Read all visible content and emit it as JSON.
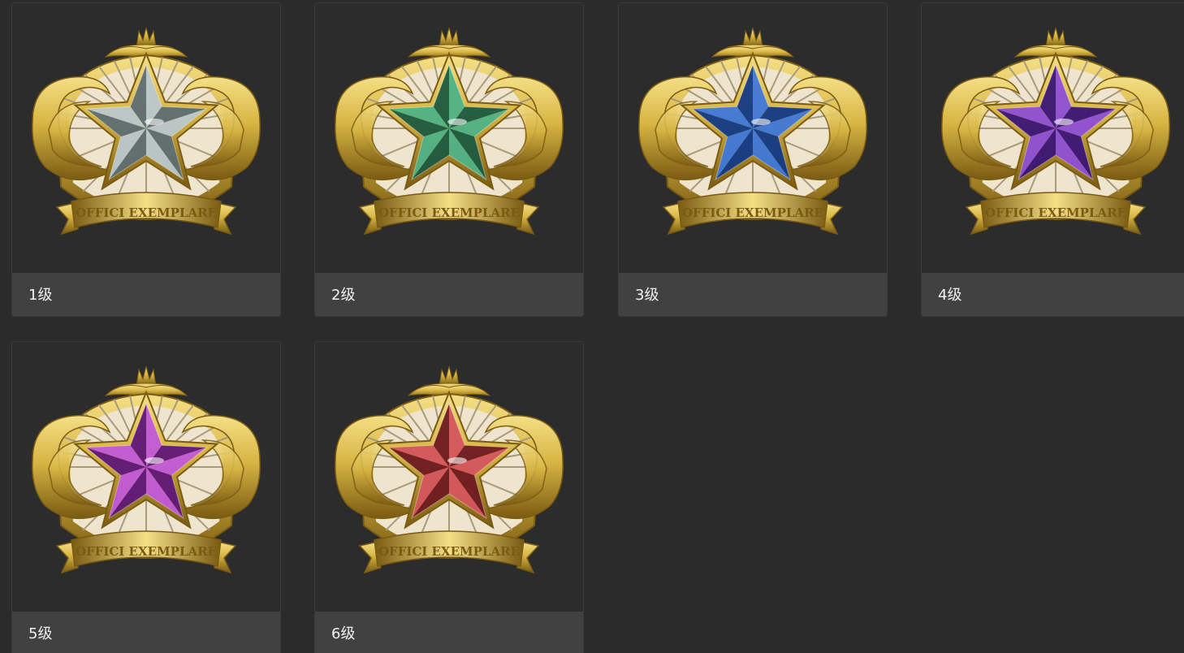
{
  "badges": [
    {
      "label": "1级",
      "ribbon_text": "OFFICI EXEMPLARE",
      "star_color": "#b9c7cc",
      "star_dark": "#5d6e73",
      "icon": "silver-star-badge-icon"
    },
    {
      "label": "2级",
      "ribbon_text": "OFFICI EXEMPLARE",
      "star_color": "#4fb287",
      "star_dark": "#1c5a41",
      "icon": "green-star-badge-icon"
    },
    {
      "label": "3级",
      "ribbon_text": "OFFICI EXEMPLARE",
      "star_color": "#3f78d9",
      "star_dark": "#123a86",
      "icon": "blue-star-badge-icon"
    },
    {
      "label": "4级",
      "ribbon_text": "OFFICI EXEMPLARE",
      "star_color": "#8e4fd6",
      "star_dark": "#3b1577",
      "icon": "purple-star-badge-icon"
    },
    {
      "label": "5级",
      "ribbon_text": "OFFICI EXEMPLARE",
      "star_color": "#c15ad8",
      "star_dark": "#5e1778",
      "icon": "magenta-star-badge-icon"
    },
    {
      "label": "6级",
      "ribbon_text": "OFFICI EXEMPLARE",
      "star_color": "#d4555d",
      "star_dark": "#6e1a22",
      "icon": "red-star-badge-icon"
    }
  ],
  "colors": {
    "background": "#2b2b2b",
    "caption_bg": "#414141",
    "gold": "#d8b544",
    "gold_dark": "#7a5b12",
    "cream": "#efe5cf"
  }
}
